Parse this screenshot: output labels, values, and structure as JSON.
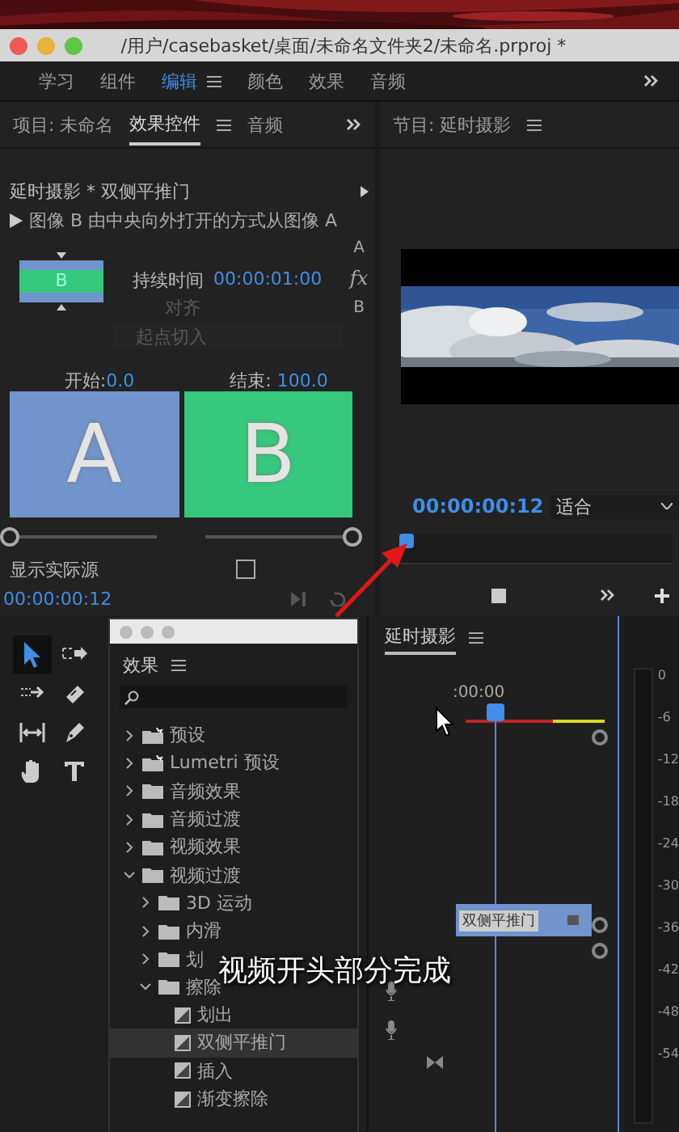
{
  "window": {
    "title": "/用户/casebasket/桌面/未命名文件夹2/未命名.prproj *"
  },
  "workspaces": [
    {
      "label": "学习",
      "selected": false
    },
    {
      "label": "组件",
      "selected": false
    },
    {
      "label": "编辑",
      "selected": true
    },
    {
      "label": "颜色",
      "selected": false
    },
    {
      "label": "效果",
      "selected": false
    },
    {
      "label": "音频",
      "selected": false
    }
  ],
  "left_panel": {
    "tabs": [
      {
        "label": "项目: 未命名",
        "selected": false
      },
      {
        "label": "效果控件",
        "selected": true
      },
      {
        "label": "音频",
        "selected": false
      }
    ]
  },
  "effect_controls": {
    "clip": "延时摄影 * 双侧平推门",
    "description": "图像 B 由中央向外打开的方式从图像 A",
    "thumbnail_label": "B",
    "duration_label": "持续时间",
    "duration": "00:00:01:00",
    "alignment_label": "对齐",
    "alignment": "起点切入",
    "alignment_disabled": true,
    "side_labels": [
      "A",
      "fx",
      "B"
    ],
    "start_label": "开始:",
    "start_value": "0.0",
    "end_label": "结束:",
    "end_value": "100.0",
    "previews": [
      {
        "label": "A",
        "color": "#7094cb"
      },
      {
        "label": "B",
        "color": "#36c87c"
      }
    ],
    "sliders": [
      {
        "level": 0
      },
      {
        "level": 1
      }
    ],
    "show_source": {
      "label": "显示实际源",
      "checked": false
    },
    "timecode": "00:00:00:12"
  },
  "program_monitor": {
    "tab": "节目: 延时摄影",
    "timecode": "00:00:00:12",
    "zoom": "适合",
    "scrub": {
      "level": 0.02
    }
  },
  "tools": [
    {
      "kind": "select",
      "selected": true
    },
    {
      "kind": "track",
      "selected": false
    },
    {
      "kind": "ripple",
      "selected": false
    },
    {
      "kind": "razor",
      "selected": false
    },
    {
      "kind": "slip",
      "selected": false
    },
    {
      "kind": "pen",
      "selected": false
    },
    {
      "kind": "hand",
      "selected": false
    },
    {
      "kind": "type",
      "selected": false
    }
  ],
  "effects_panel": {
    "title": "效果",
    "tree": [
      {
        "kind": "preset",
        "label": "预设",
        "expanded": false,
        "selected": false
      },
      {
        "kind": "preset",
        "label": "Lumetri 预设",
        "expanded": false,
        "selected": false
      },
      {
        "kind": "folder",
        "label": "音频效果",
        "expanded": false,
        "selected": false
      },
      {
        "kind": "folder",
        "label": "音频过渡",
        "expanded": false,
        "selected": false
      },
      {
        "kind": "folder",
        "label": "视频效果",
        "expanded": false,
        "selected": false
      },
      {
        "kind": "folder",
        "label": "视频过渡",
        "expanded": true,
        "selected": false,
        "children": [
          {
            "kind": "folder",
            "label": "3D 运动",
            "expanded": false,
            "selected": false
          },
          {
            "kind": "folder",
            "label": "内滑",
            "expanded": false,
            "selected": false
          },
          {
            "kind": "folder",
            "label": "划",
            "expanded": false,
            "selected": false
          },
          {
            "kind": "folder",
            "label": "擦除",
            "expanded": true,
            "selected": false,
            "children": [
              {
                "kind": "transition",
                "label": "划出",
                "selected": false
              },
              {
                "kind": "transition",
                "label": "双侧平推门",
                "selected": true
              },
              {
                "kind": "transition",
                "label": "插入",
                "selected": false
              },
              {
                "kind": "transition",
                "label": "渐变擦除",
                "selected": false
              }
            ]
          }
        ]
      }
    ]
  },
  "timeline": {
    "tab": "延时摄影",
    "timecode": ":00:00",
    "clip": "双侧平推门"
  },
  "audio_meter": {
    "scale": [
      "0",
      "-6",
      "-12",
      "-18",
      "-24",
      "-30",
      "-36",
      "-42",
      "-48",
      "-54"
    ]
  },
  "caption": "视频开头部分完成"
}
